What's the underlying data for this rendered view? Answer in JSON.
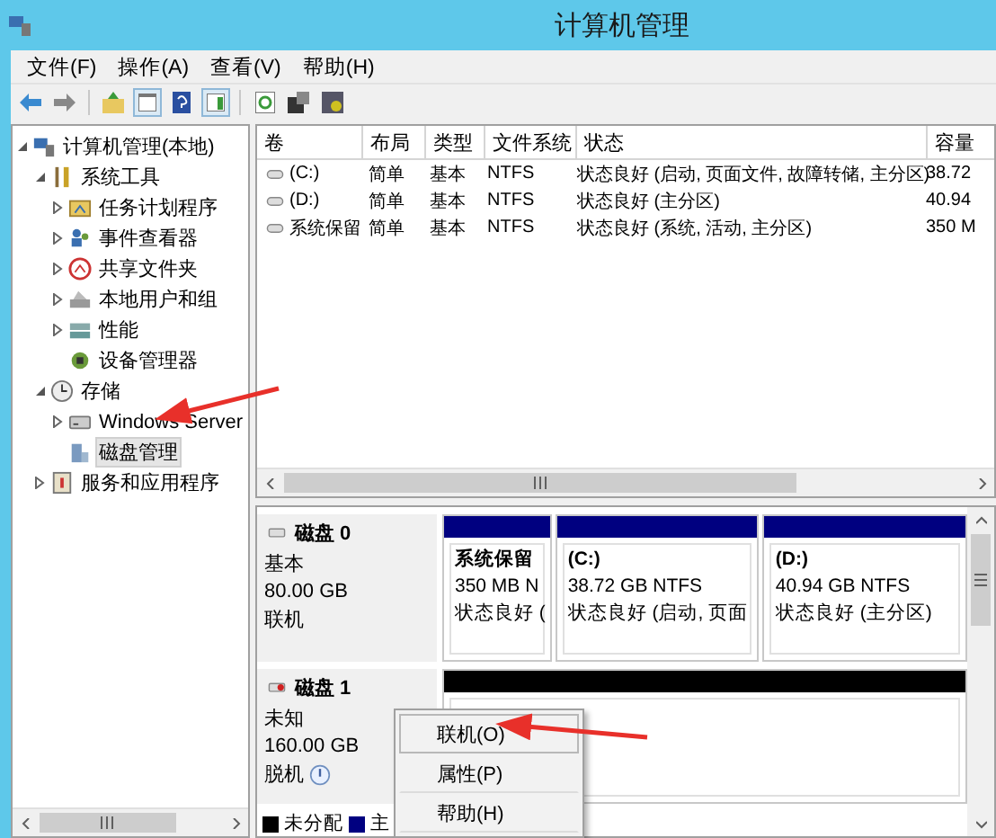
{
  "window": {
    "title": "计算机管理"
  },
  "menu": [
    "文件(F)",
    "操作(A)",
    "查看(V)",
    "帮助(H)"
  ],
  "tree": [
    {
      "label": "计算机管理(本地)",
      "selected": false,
      "expanded": true,
      "children": [
        {
          "label": "系统工具",
          "selected": false,
          "expanded": true,
          "children": [
            {
              "label": "任务计划程序",
              "selected": false,
              "expanded": false
            },
            {
              "label": "事件查看器",
              "selected": false,
              "expanded": false
            },
            {
              "label": "共享文件夹",
              "selected": false,
              "expanded": false
            },
            {
              "label": "本地用户和组",
              "selected": false,
              "expanded": false
            },
            {
              "label": "性能",
              "selected": false,
              "expanded": false
            },
            {
              "label": "设备管理器",
              "selected": false
            }
          ]
        },
        {
          "label": "存储",
          "selected": false,
          "expanded": true,
          "children": [
            {
              "label": "Windows Server",
              "selected": false,
              "expanded": false
            },
            {
              "label": "磁盘管理",
              "selected": true
            }
          ]
        },
        {
          "label": "服务和应用程序",
          "selected": false,
          "expanded": false
        }
      ]
    }
  ],
  "table": {
    "columns": [
      "卷",
      "布局",
      "类型",
      "文件系统",
      "状态",
      "容量"
    ],
    "rows": [
      [
        "(C:)",
        "简单",
        "基本",
        "NTFS",
        "状态良好 (启动, 页面文件, 故障转储, 主分区)",
        "38.72"
      ],
      [
        "(D:)",
        "简单",
        "基本",
        "NTFS",
        "状态良好 (主分区)",
        "40.94"
      ],
      [
        "系统保留",
        "简单",
        "基本",
        "NTFS",
        "状态良好 (系统, 活动, 主分区)",
        "350 M"
      ]
    ]
  },
  "disks": [
    {
      "name": "磁盘 0",
      "type": "基本",
      "size": "80.00 GB",
      "status": "联机",
      "offline": false,
      "partitions": [
        {
          "title": "系统保留",
          "size": "350 MB N",
          "status": "状态良好 (",
          "color": "#000080"
        },
        {
          "title": "(C:)",
          "size": "38.72 GB NTFS",
          "status": "状态良好 (启动, 页面",
          "color": "#000080"
        },
        {
          "title": "(D:)",
          "size": "40.94 GB NTFS",
          "status": "状态良好 (主分区)",
          "color": "#000080"
        }
      ]
    },
    {
      "name": "磁盘 1",
      "type": "未知",
      "size": "160.00 GB",
      "status": "脱机",
      "offline": true,
      "partitions": [
        {
          "color": "#000000"
        }
      ]
    }
  ],
  "legend": [
    {
      "label": "未分配",
      "color": "#000000"
    },
    {
      "label": "主",
      "color": "#000080"
    }
  ],
  "context_menu": [
    {
      "label": "联机(O)",
      "selected": true
    },
    {
      "label": "属性(P)",
      "selected": false
    },
    {
      "label": "帮助(H)",
      "selected": false
    }
  ]
}
